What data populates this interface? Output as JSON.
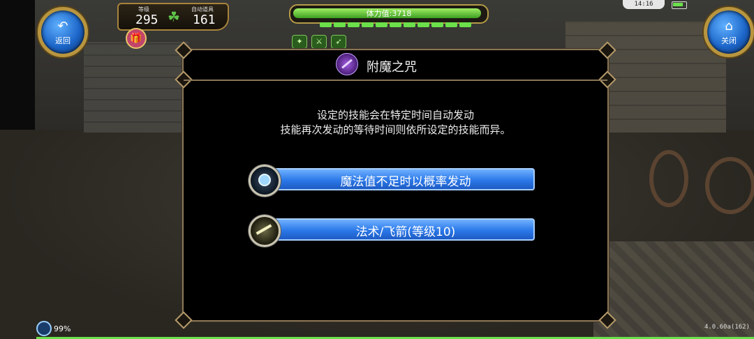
{
  "hud": {
    "back_label": "返回",
    "close_label": "关闭",
    "level_label": "等级",
    "level_value": "295",
    "auto_item_label": "自动道具",
    "auto_item_value": "161",
    "hp_text": "体力值:3718",
    "hp_fraction": 0.98,
    "mp_segments": 11,
    "buff_icons": [
      "mp-buff-icon",
      "sword-buff-icon",
      "bow-buff-icon"
    ],
    "clock": "14:16",
    "load_percent": "99%",
    "version": "4.0.60a(162)"
  },
  "dialog": {
    "title": "附魔之咒",
    "description_line1": "设定的技能会在特定时间自动发动",
    "description_line2": "技能再次发动的等待时间则依所设定的技能而异。",
    "options": [
      {
        "label": "魔法值不足时以概率发动",
        "icon": "mana-eye-icon"
      },
      {
        "label": "法术/飞箭(等级10)",
        "icon": "arrow-spell-icon"
      }
    ]
  },
  "colors": {
    "accent_blue": "#2b78e8",
    "frame_gold": "#b59a47",
    "hp_green": "#6be04a"
  }
}
